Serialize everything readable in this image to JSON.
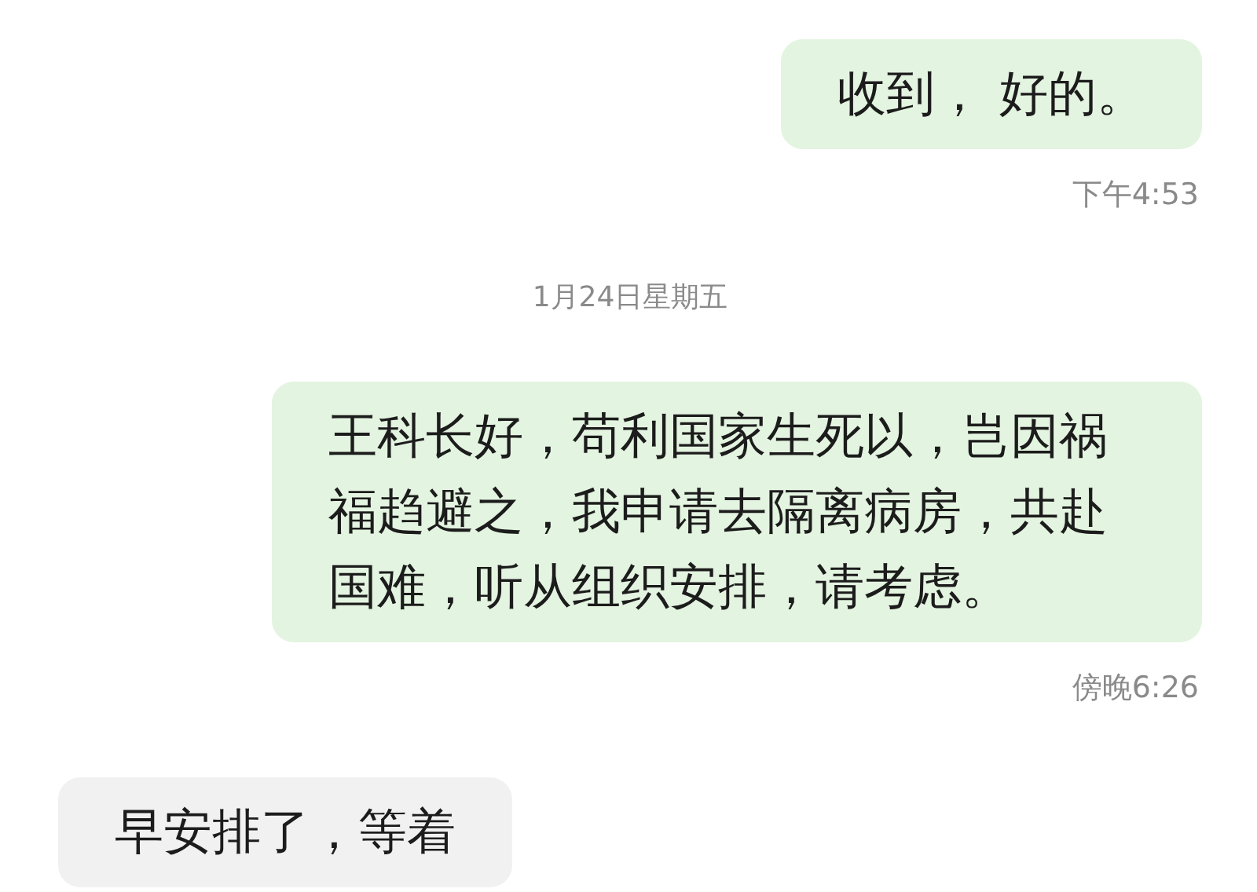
{
  "messages": [
    {
      "kind": "outgoing",
      "text": "收到， 好的。",
      "time": "下午4:53"
    },
    {
      "kind": "date",
      "text": "1月24日星期五"
    },
    {
      "kind": "outgoing",
      "text": "王科长好，苟利国家生死以，岂因祸福趋避之，我申请去隔离病房，共赴国难，听从组织安排，请考虑。",
      "time": "傍晚6:26"
    },
    {
      "kind": "incoming",
      "text": "早安排了，等着"
    }
  ]
}
